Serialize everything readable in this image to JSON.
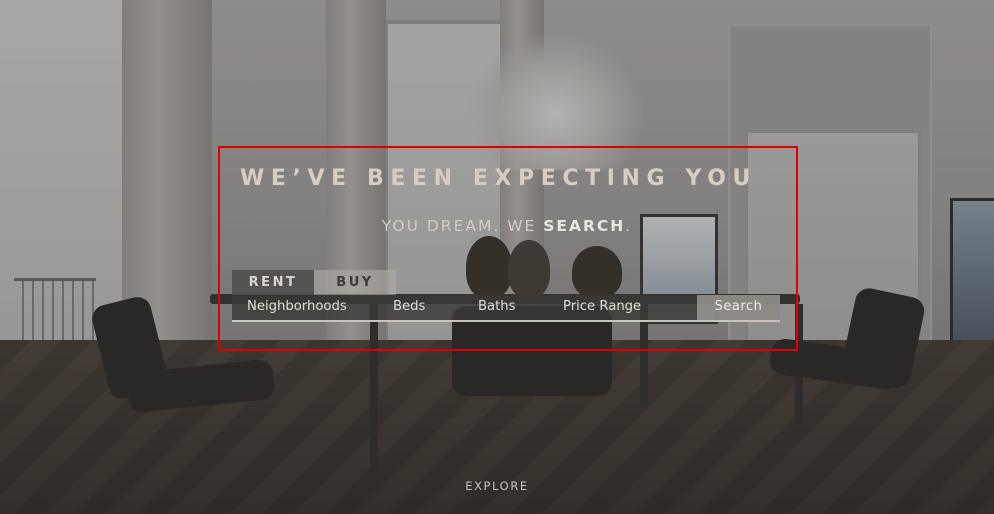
{
  "hero": {
    "title": "WE’VE BEEN EXPECTING YOU",
    "subtitle_prefix": "YOU DREAM. WE ",
    "subtitle_emphasis": "SEARCH",
    "subtitle_suffix": "."
  },
  "tabs": [
    {
      "label": "RENT",
      "active": true
    },
    {
      "label": "BUY",
      "active": false
    }
  ],
  "search": {
    "filters": [
      "Neighborhoods",
      "Beds",
      "Baths",
      "Price Range"
    ],
    "button_label": "Search"
  },
  "footer": {
    "explore_label": "EXPLORE"
  },
  "colors": {
    "highlight_border": "#e00000",
    "title_text": "#d9ccc0"
  }
}
